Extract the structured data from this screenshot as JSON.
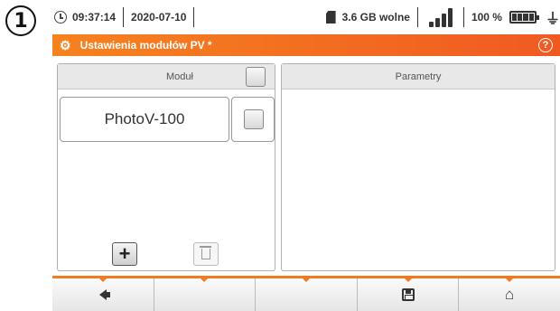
{
  "callout": "1",
  "status": {
    "time": "09:37:14",
    "date": "2020-07-10",
    "storage": "3.6 GB wolne",
    "battery": "100 %",
    "icons": [
      "clock-icon",
      "sd-card-icon",
      "signal-icon",
      "battery-icon",
      "plug-icon"
    ]
  },
  "title": {
    "text": "Ustawienia modułów PV *",
    "icons": [
      "gears-icon",
      "help-icon"
    ]
  },
  "module_panel": {
    "header": "Moduł",
    "items": [
      {
        "label": "PhotoV-100",
        "checked": false
      }
    ],
    "buttons": [
      "add-icon",
      "delete-icon"
    ]
  },
  "params_panel": {
    "header": "Parametry"
  },
  "bottom_bar": {
    "keys": [
      "back-icon",
      "",
      "",
      "save-icon",
      "home-icon"
    ]
  },
  "colors": {
    "accent": "#f37a1f"
  }
}
